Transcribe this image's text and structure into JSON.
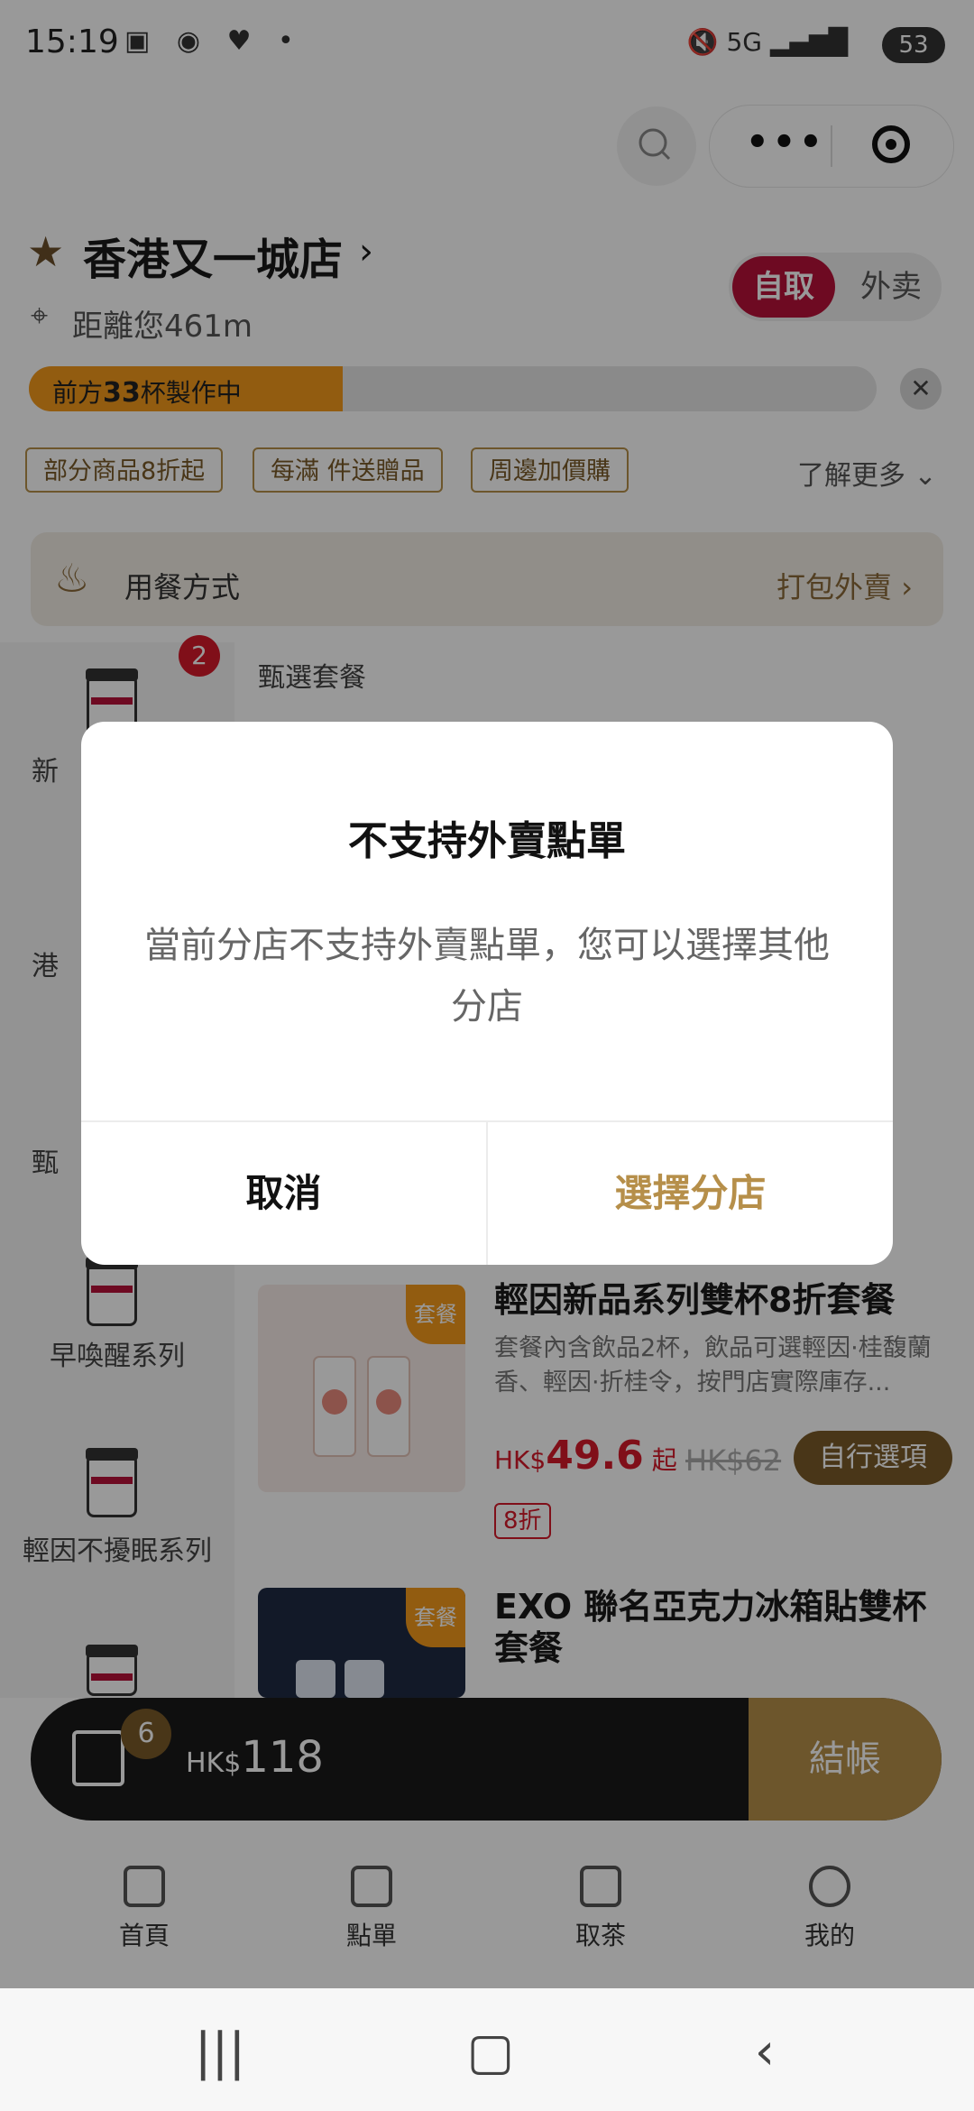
{
  "status_bar": {
    "time": "15:19",
    "network": "5G",
    "battery": "53"
  },
  "store": {
    "name": "香港又一城店",
    "distance": "距離您461m"
  },
  "mode_toggle": {
    "pickup": "自取",
    "delivery": "外卖"
  },
  "queue": {
    "prefix": "前方",
    "count": "33",
    "suffix": "杯製作中",
    "progress": 0.37
  },
  "promos": [
    "部分商品8折起",
    "每滿 件送贈品",
    "周邊加價購"
  ],
  "learn_more": "了解更多",
  "dining": {
    "label": "用餐方式",
    "value": "打包外賣"
  },
  "categories": [
    {
      "label": "新",
      "badge": "2"
    },
    {
      "label": "港"
    },
    {
      "label": "甄"
    },
    {
      "label": "早喚醒系列"
    },
    {
      "label": "輕因不擾眠系列"
    }
  ],
  "section_title": "甄選套餐",
  "products": [
    {
      "title": "輕因新品系列雙杯8折套餐",
      "desc": "套餐內含飲品2杯，飲品可選輕因·桂馥蘭香、輕因·折桂令，按門店實際庫存...",
      "price_prefix": "HK$",
      "price": "49.6",
      "price_suffix": "起",
      "old_price": "HK$62",
      "button": "自行選項",
      "discount": "8折",
      "thumb_tag": "套餐"
    },
    {
      "title": "EXO 聯名亞克力冰箱貼雙杯套餐",
      "thumb_tag": "套餐"
    }
  ],
  "cart": {
    "count": "6",
    "currency": "HK$",
    "total": "118",
    "checkout": "結帳"
  },
  "tabs": [
    {
      "label": "首頁",
      "icon": "home-icon"
    },
    {
      "label": "點單",
      "icon": "cup-icon"
    },
    {
      "label": "取茶",
      "icon": "bag-icon"
    },
    {
      "label": "我的",
      "icon": "user-icon"
    }
  ],
  "dialog": {
    "title": "不支持外賣點單",
    "message": "當前分店不支持外賣點單，您可以選擇其他分店",
    "cancel": "取消",
    "confirm": "選擇分店"
  },
  "colors": {
    "brand_red": "#b8123a",
    "gold": "#b68f4a",
    "progress": "#f39a1c"
  }
}
